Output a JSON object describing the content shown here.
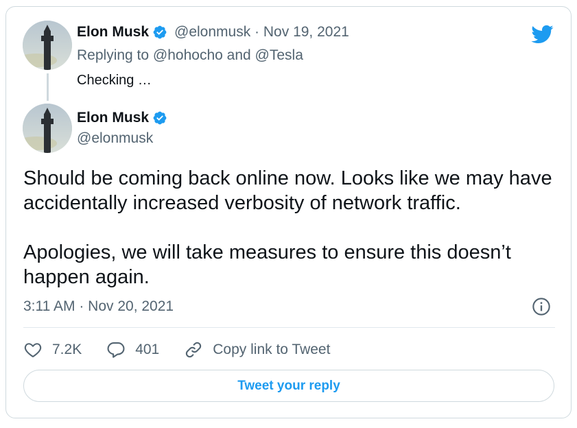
{
  "parent_tweet": {
    "author_name": "Elon Musk",
    "handle": "@elonmusk",
    "separator": " · ",
    "date": "Nov 19, 2021",
    "replying_prefix": "Replying to ",
    "replying_user1": "@hohocho",
    "replying_and": " and ",
    "replying_user2": "@Tesla",
    "text": "Checking …"
  },
  "main_tweet": {
    "author_name": "Elon Musk",
    "handle": "@elonmusk",
    "paragraph1": "Should be coming back online now. Looks like we may have accidentally increased verbosity of network traffic.",
    "paragraph2": "Apologies, we will take measures to ensure this doesn’t happen again.",
    "time": "3:11 AM",
    "separator": " · ",
    "date": "Nov 20, 2021"
  },
  "actions": {
    "likes": "7.2K",
    "replies": "401",
    "copy_link": "Copy link to Tweet"
  },
  "reply_button": "Tweet your reply",
  "colors": {
    "accent": "#1d9bf0",
    "muted_text": "#536471",
    "border": "#cfd9de"
  },
  "icons": [
    "twitter-bird-icon",
    "verified-badge-icon",
    "heart-icon",
    "reply-bubble-icon",
    "link-icon",
    "info-icon"
  ]
}
